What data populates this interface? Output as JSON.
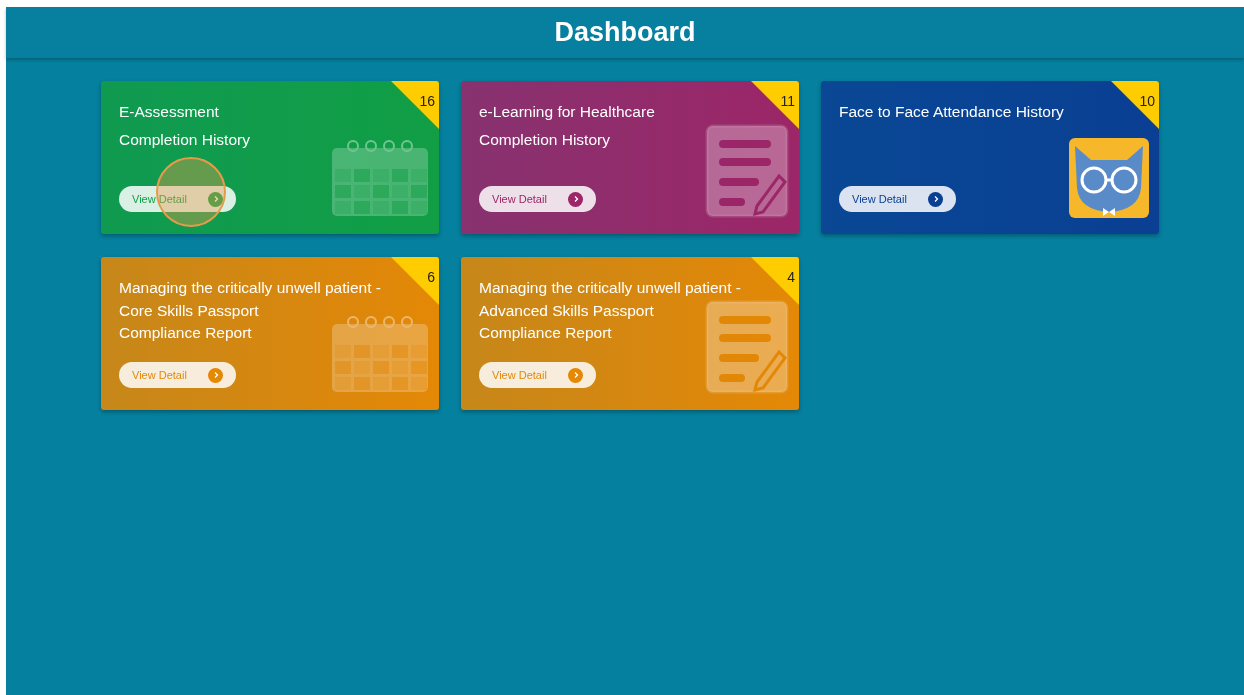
{
  "header": {
    "title": "Dashboard"
  },
  "cards": [
    {
      "title_lines": [
        "E-Assessment",
        "Completion History"
      ],
      "count": "16",
      "button": "View Detail",
      "color": "#119e45",
      "kind": "calendar",
      "touched": true
    },
    {
      "title_lines": [
        "e-Learning for Healthcare",
        "Completion History"
      ],
      "count": "11",
      "button": "View Detail",
      "color": "#9c2668",
      "kind": "document",
      "touched": false
    },
    {
      "title_lines": [
        "Face to Face Attendance History"
      ],
      "count": "10",
      "button": "View Detail",
      "color": "#0a3f93",
      "kind": "cat",
      "touched": false
    },
    {
      "title_lines": [
        "Managing the critically unwell patient -",
        "Core Skills Passport",
        "Compliance Report"
      ],
      "count": "6",
      "button": "View Detail",
      "color": "#e48806",
      "kind": "calendar",
      "touched": false
    },
    {
      "title_lines": [
        "Managing the critically unwell patient -",
        "Advanced Skills Passport",
        "Compliance Report"
      ],
      "count": "4",
      "button": "View Detail",
      "color": "#e48806",
      "kind": "document",
      "touched": false
    }
  ]
}
